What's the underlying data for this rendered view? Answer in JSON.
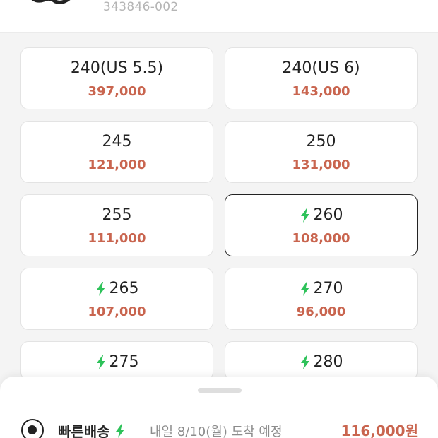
{
  "product": {
    "model_code": "343846-002"
  },
  "sizes": [
    {
      "label": "240(US 5.5)",
      "price": "397,000",
      "express": false,
      "selected": false
    },
    {
      "label": "240(US 6)",
      "price": "143,000",
      "express": false,
      "selected": false
    },
    {
      "label": "245",
      "price": "121,000",
      "express": false,
      "selected": false
    },
    {
      "label": "250",
      "price": "131,000",
      "express": false,
      "selected": false
    },
    {
      "label": "255",
      "price": "111,000",
      "express": false,
      "selected": false
    },
    {
      "label": "260",
      "price": "108,000",
      "express": true,
      "selected": true
    },
    {
      "label": "265",
      "price": "107,000",
      "express": true,
      "selected": false
    },
    {
      "label": "270",
      "price": "96,000",
      "express": true,
      "selected": false
    },
    {
      "label": "275",
      "price": "",
      "express": true,
      "selected": false
    },
    {
      "label": "280",
      "price": "",
      "express": true,
      "selected": false
    }
  ],
  "shipping": {
    "label": "빠른배송",
    "note": "내일 8/10(월) 도착 예정",
    "price": "116,000원",
    "icon": "lightning-bolt-icon",
    "selected": true
  },
  "colors": {
    "price": "#c9654f",
    "express": "#2ec25a",
    "text": "#222222"
  }
}
